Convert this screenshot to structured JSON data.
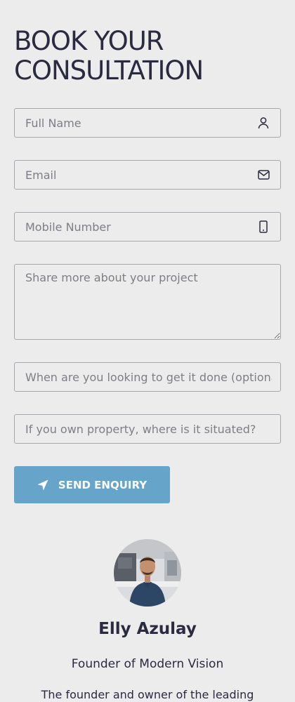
{
  "form": {
    "heading": "BOOK YOUR CONSULTATION",
    "full_name": {
      "placeholder": "Full Name",
      "icon": "user-icon",
      "value": ""
    },
    "email": {
      "placeholder": "Email",
      "icon": "envelope-icon",
      "value": ""
    },
    "mobile": {
      "placeholder": "Mobile Number",
      "icon": "mobile-phone-icon",
      "value": ""
    },
    "project": {
      "placeholder": "Share more about your project",
      "value": ""
    },
    "timeline": {
      "placeholder": "When are you looking to get it done (optional)?",
      "value": ""
    },
    "property": {
      "placeholder": "If you own property, where is it situated?",
      "value": ""
    },
    "submit": {
      "label": "SEND ENQUIRY",
      "icon": "paper-plane-icon"
    }
  },
  "profile": {
    "name": "Elly Azulay",
    "role": "Founder of Modern Vision",
    "bio": "The founder and owner of the leading"
  },
  "colors": {
    "background": "#ececec",
    "heading": "#2b2b40",
    "button": "#66a4ca",
    "field_border": "#a6a6ac"
  }
}
